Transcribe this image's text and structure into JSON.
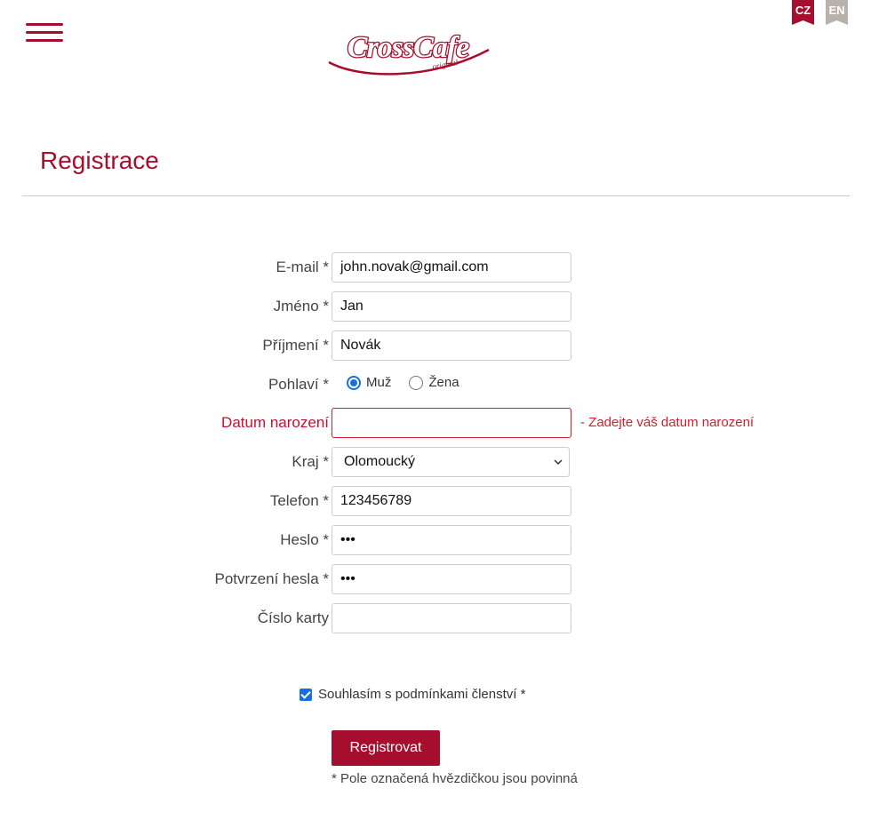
{
  "header": {
    "logo_text": "CrossCafe",
    "logo_subtext": "original",
    "languages": [
      {
        "code": "CZ",
        "active": true
      },
      {
        "code": "EN",
        "active": false
      }
    ]
  },
  "page": {
    "title": "Registrace"
  },
  "form": {
    "email": {
      "label": "E-mail *",
      "value": "john.novak@gmail.com"
    },
    "first_name": {
      "label": "Jméno *",
      "value": "Jan"
    },
    "last_name": {
      "label": "Příjmení *",
      "value": "Novák"
    },
    "gender": {
      "label": "Pohlaví *",
      "options": [
        {
          "label": "Muž",
          "selected": true
        },
        {
          "label": "Žena",
          "selected": false
        }
      ]
    },
    "birth_date": {
      "label": "Datum narození",
      "value": "",
      "error": "- Zadejte váš datum narození"
    },
    "region": {
      "label": "Kraj *",
      "value": "Olomoucký"
    },
    "phone": {
      "label": "Telefon *",
      "value": "123456789"
    },
    "password": {
      "label": "Heslo *",
      "value": "•••"
    },
    "password_confirm": {
      "label": "Potvrzení hesla *",
      "value": "•••"
    },
    "card_number": {
      "label": "Číslo karty",
      "value": ""
    },
    "consent": {
      "label": "Souhlasím s podmínkami členství *",
      "checked": true
    },
    "submit_label": "Registrovat",
    "required_note": "* Pole označená hvězdičkou jsou povinná"
  },
  "colors": {
    "brand": "#a50f2d",
    "error": "#d21f2c",
    "accent": "#1a6fe0",
    "lang_inactive": "#b8b2ab"
  }
}
